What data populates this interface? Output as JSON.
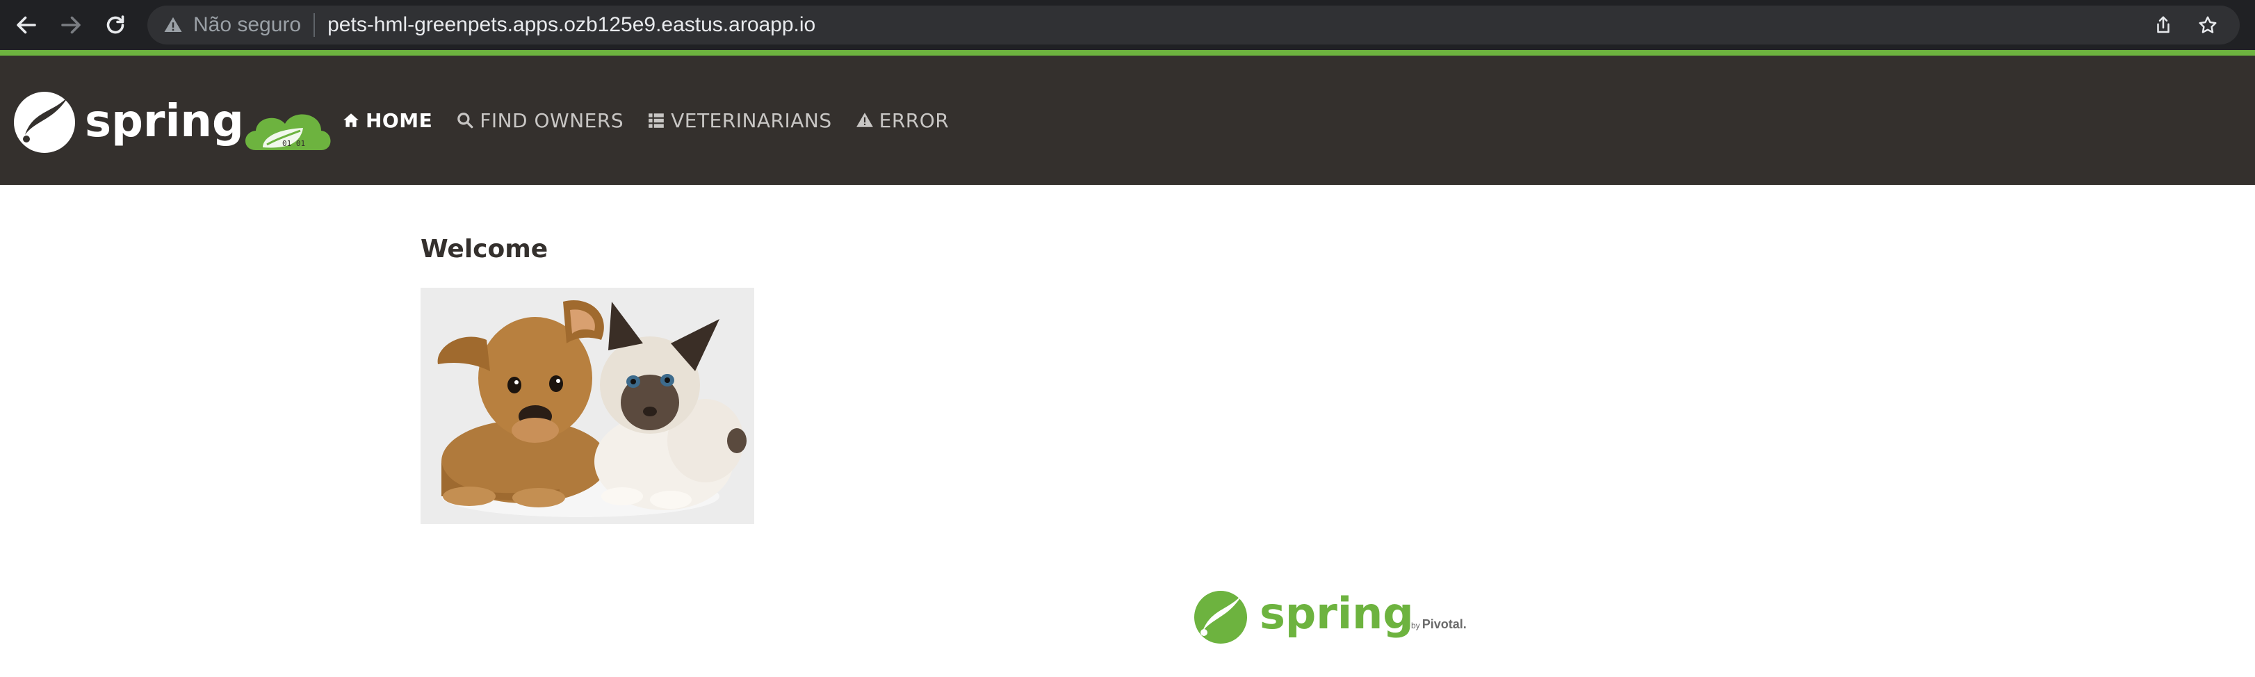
{
  "browser": {
    "security_label": "Não seguro",
    "url": "pets-hml-greenpets.apps.ozb125e9.eastus.aroapp.io",
    "icons": [
      "back-arrow-icon",
      "forward-arrow-icon",
      "reload-icon",
      "warning-icon",
      "share-icon",
      "bookmark-star-icon"
    ]
  },
  "navbar": {
    "brand": "spring",
    "brand_badge_text": "01 01",
    "items": [
      {
        "label": "HOME",
        "icon": "home-icon",
        "active": true
      },
      {
        "label": "FIND OWNERS",
        "icon": "search-icon",
        "active": false
      },
      {
        "label": "VETERINARIANS",
        "icon": "list-icon",
        "active": false
      },
      {
        "label": "ERROR",
        "icon": "warning-icon",
        "active": false
      }
    ]
  },
  "main": {
    "title": "Welcome"
  },
  "footer": {
    "brand": "spring",
    "byline_prefix": "by",
    "byline_company": "Pivotal."
  },
  "colors": {
    "browser_bar": "#202124",
    "omnibox": "#303134",
    "accent": "#6db33f",
    "navbar": "#34302d",
    "nav_active": "#ffffff",
    "nav_inactive": "#c8c6c4",
    "title": "#34302d"
  }
}
